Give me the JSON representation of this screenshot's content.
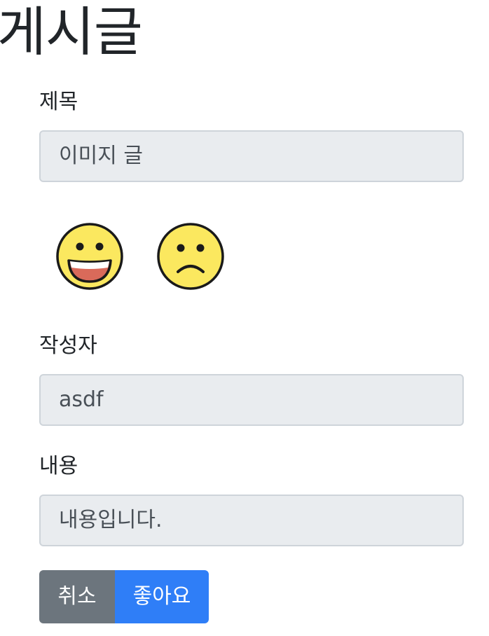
{
  "page": {
    "title": "게시글"
  },
  "form": {
    "title_label": "제목",
    "title_value": "이미지 글",
    "author_label": "작성자",
    "author_value": "asdf",
    "content_label": "내용",
    "content_value": "내용입니다."
  },
  "reactions": {
    "like_icon": "grinning-face-emoji",
    "dislike_icon": "frowning-face-emoji"
  },
  "actions": {
    "cancel_label": "취소",
    "like_label": "좋아요"
  },
  "colors": {
    "input_bg": "#e9ecef",
    "cancel_button": "#6c757d",
    "like_button": "#2f7ef7",
    "emoji_face": "#fbe85f"
  }
}
